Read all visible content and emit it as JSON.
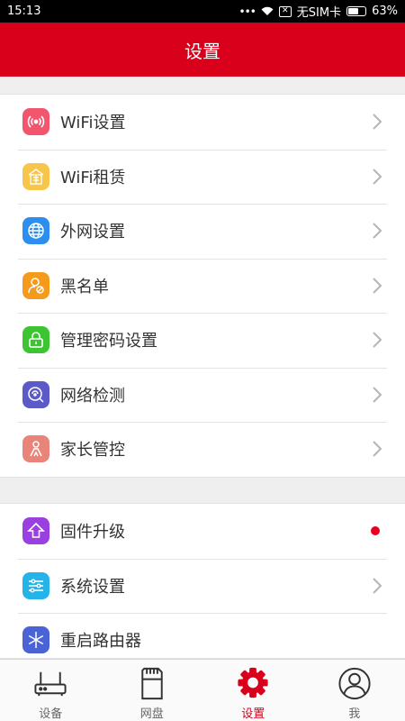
{
  "status_bar": {
    "time": "15:13",
    "carrier": "无SIM卡",
    "battery": "63%",
    "battery_level": 0.63
  },
  "header": {
    "title": "设置"
  },
  "group1": [
    {
      "label": "WiFi设置",
      "icon": "wifi-signal-icon",
      "color": "#f2566e"
    },
    {
      "label": "WiFi租赁",
      "icon": "rent-icon",
      "color": "#f7c54a"
    },
    {
      "label": "外网设置",
      "icon": "globe-icon",
      "color": "#2c8ff0"
    },
    {
      "label": "黑名单",
      "icon": "user-block-icon",
      "color": "#f59b1c"
    },
    {
      "label": "管理密码设置",
      "icon": "lock-icon",
      "color": "#3cc433"
    },
    {
      "label": "网络检测",
      "icon": "network-check-icon",
      "color": "#5c59c8"
    },
    {
      "label": "家长管控",
      "icon": "parent-control-icon",
      "color": "#e8847a"
    }
  ],
  "group2": [
    {
      "label": "固件升级",
      "icon": "upgrade-icon",
      "color": "#9a3fe0"
    },
    {
      "label": "系统设置",
      "icon": "sliders-icon",
      "color": "#25b4e8"
    },
    {
      "label": "重启路由器",
      "icon": "restart-icon",
      "color": "#4a63d6"
    }
  ],
  "tabs": [
    {
      "label": "设备",
      "icon": "router-icon"
    },
    {
      "label": "网盘",
      "icon": "sd-card-icon"
    },
    {
      "label": "设置",
      "icon": "gear-icon"
    },
    {
      "label": "我",
      "icon": "profile-icon"
    }
  ],
  "colors": {
    "brand": "#d9001b",
    "badge": "#e8001c"
  }
}
